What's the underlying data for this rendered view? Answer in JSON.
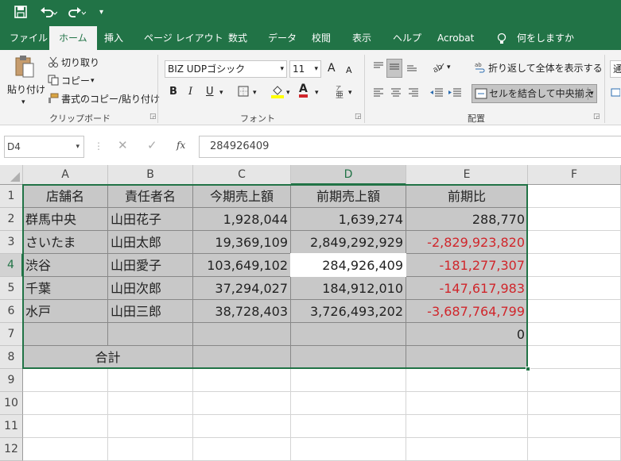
{
  "qat": {
    "save_icon": "save-icon",
    "undo_icon": "undo-icon",
    "redo_icon": "redo-icon",
    "customize_icon": "customize-qat-icon"
  },
  "tabs": [
    {
      "label": "ファイル"
    },
    {
      "label": "ホーム"
    },
    {
      "label": "挿入"
    },
    {
      "label": "ページ レイアウト"
    },
    {
      "label": "数式"
    },
    {
      "label": "データ"
    },
    {
      "label": "校閲"
    },
    {
      "label": "表示"
    },
    {
      "label": "ヘルプ"
    },
    {
      "label": "Acrobat"
    },
    {
      "label": "何をしますか"
    }
  ],
  "ribbon": {
    "clipboard": {
      "paste": "貼り付け",
      "cut": "切り取り",
      "copy": "コピー",
      "format_painter": "書式のコピー/貼り付け",
      "group": "クリップボード"
    },
    "font": {
      "font_name": "BIZ UDPゴシック",
      "font_size": "11",
      "bold": "B",
      "italic": "I",
      "underline": "U",
      "grow": "A",
      "shrink": "A",
      "font_color_letter": "A",
      "group": "フォント"
    },
    "alignment": {
      "wrap_text": "折り返して全体を表示する",
      "merge_center": "セルを結合して中央揃え",
      "group": "配置"
    },
    "number": {
      "format_partial": "通"
    }
  },
  "formula_bar": {
    "name_box": "D4",
    "fx": "fx",
    "content": "284926409"
  },
  "columns": [
    "A",
    "B",
    "C",
    "D",
    "E",
    "F"
  ],
  "rows": [
    "1",
    "2",
    "3",
    "4",
    "5",
    "6",
    "7",
    "8",
    "9",
    "10",
    "11",
    "12"
  ],
  "table": {
    "header": [
      "店舗名",
      "責任者名",
      "今期売上額",
      "前期売上額",
      "前期比"
    ],
    "rows": [
      [
        "群馬中央",
        "山田花子",
        "1,928,044",
        "1,639,274",
        "288,770"
      ],
      [
        "さいたま",
        "山田太郎",
        "19,369,109",
        "2,849,292,929",
        "-2,829,923,820"
      ],
      [
        "渋谷",
        "山田愛子",
        "103,649,102",
        "284,926,409",
        "-181,277,307"
      ],
      [
        "千葉",
        "山田次郎",
        "37,294,027",
        "184,912,010",
        "-147,617,983"
      ],
      [
        "水戸",
        "山田三郎",
        "38,728,403",
        "3,726,493,202",
        "-3,687,764,799"
      ],
      [
        "",
        "",
        "",
        "",
        "0"
      ]
    ],
    "total_label": "合計"
  },
  "colors": {
    "ribbon_green": "#217346",
    "cell_shade": "#c8c8c8",
    "negative": "#d0262b"
  }
}
